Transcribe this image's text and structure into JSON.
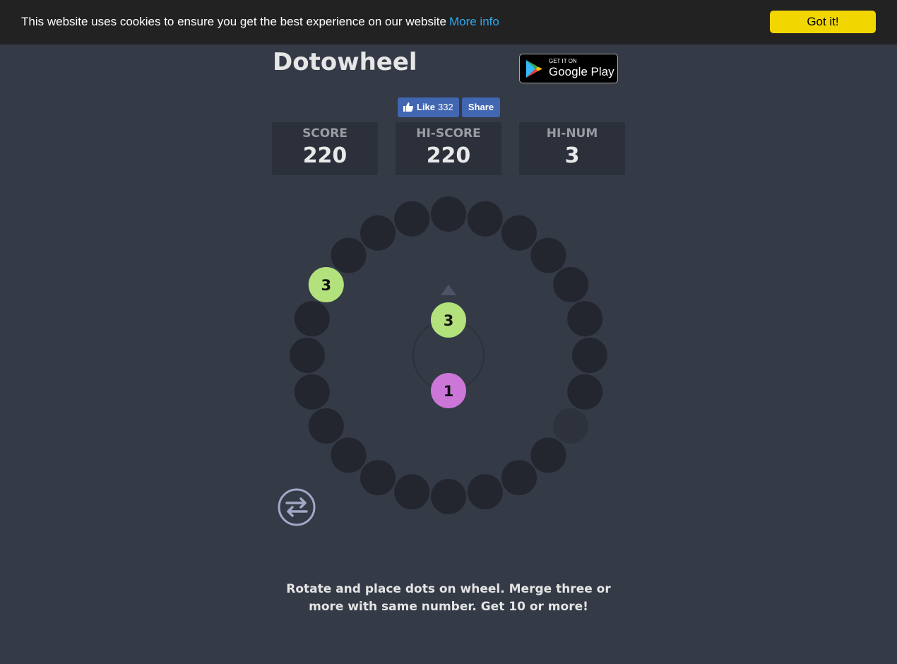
{
  "cookie_banner": {
    "message": "This website uses cookies to ensure you get the best experience on our website",
    "more_info_label": "More info",
    "accept_label": "Got it!"
  },
  "header": {
    "title": "Dotowheel",
    "google_play": {
      "small_text": "GET IT ON",
      "big_text": "Google Play"
    }
  },
  "social": {
    "like_label": "Like",
    "like_count": "332",
    "share_label": "Share"
  },
  "stats": [
    {
      "label": "SCORE",
      "value": "220"
    },
    {
      "label": "HI-SCORE",
      "value": "220"
    },
    {
      "label": "HI-NUM",
      "value": "3"
    }
  ],
  "wheel": {
    "slot_count": 24,
    "filled_slots": [
      {
        "slot": 20,
        "number": "3",
        "color": "#b3e27c"
      }
    ],
    "highlighted_slot": 8,
    "current_dot": {
      "number": "3",
      "color": "#b3e27c"
    },
    "next_dot": {
      "number": "1",
      "color": "#cc77d8"
    }
  },
  "colors": {
    "background": "#343a46",
    "slot_empty": "#23262f",
    "slot_highlight": "#2e323c",
    "pointer": "#4e5467",
    "swap_icon": "#a2a8c6",
    "cookie_accept": "#f1d600",
    "cookie_link": "#31a8f0"
  },
  "instructions": "Rotate and place dots on wheel. Merge three or more with same number. Get 10 or more!"
}
